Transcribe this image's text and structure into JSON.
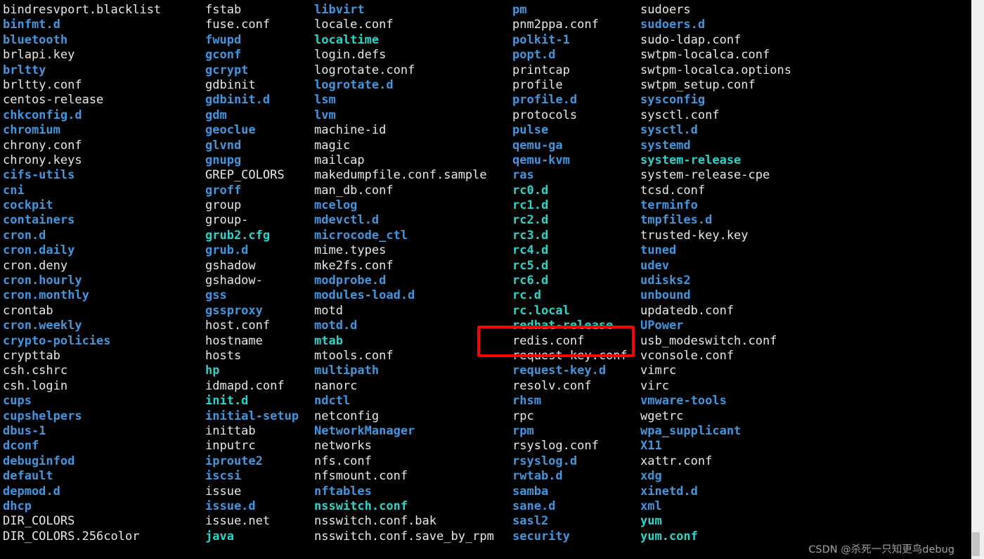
{
  "terminal": {
    "description": "Directory listing of /etc produced by ls",
    "background_color": "#000000",
    "colors": {
      "file": "#e8e8e8",
      "directory": "#4196de",
      "symlink": "#2ad4c8",
      "highlight_border": "#ff0000",
      "scrollbar_track": "#efefef",
      "scrollbar_thumb": "#c4c4c4"
    },
    "columns": [
      {
        "id": "column-1",
        "entries": [
          {
            "name": "bindresvport.blacklist",
            "type": "file"
          },
          {
            "name": "binfmt.d",
            "type": "dir"
          },
          {
            "name": "bluetooth",
            "type": "dir"
          },
          {
            "name": "brlapi.key",
            "type": "file"
          },
          {
            "name": "brltty",
            "type": "dir"
          },
          {
            "name": "brltty.conf",
            "type": "file"
          },
          {
            "name": "centos-release",
            "type": "file"
          },
          {
            "name": "chkconfig.d",
            "type": "dir"
          },
          {
            "name": "chromium",
            "type": "dir"
          },
          {
            "name": "chrony.conf",
            "type": "file"
          },
          {
            "name": "chrony.keys",
            "type": "file"
          },
          {
            "name": "cifs-utils",
            "type": "dir"
          },
          {
            "name": "cni",
            "type": "dir"
          },
          {
            "name": "cockpit",
            "type": "dir"
          },
          {
            "name": "containers",
            "type": "dir"
          },
          {
            "name": "cron.d",
            "type": "dir"
          },
          {
            "name": "cron.daily",
            "type": "dir"
          },
          {
            "name": "cron.deny",
            "type": "file"
          },
          {
            "name": "cron.hourly",
            "type": "dir"
          },
          {
            "name": "cron.monthly",
            "type": "dir"
          },
          {
            "name": "crontab",
            "type": "file"
          },
          {
            "name": "cron.weekly",
            "type": "dir"
          },
          {
            "name": "crypto-policies",
            "type": "dir"
          },
          {
            "name": "crypttab",
            "type": "file"
          },
          {
            "name": "csh.cshrc",
            "type": "file"
          },
          {
            "name": "csh.login",
            "type": "file"
          },
          {
            "name": "cups",
            "type": "dir"
          },
          {
            "name": "cupshelpers",
            "type": "dir"
          },
          {
            "name": "dbus-1",
            "type": "dir"
          },
          {
            "name": "dconf",
            "type": "dir"
          },
          {
            "name": "debuginfod",
            "type": "dir"
          },
          {
            "name": "default",
            "type": "dir"
          },
          {
            "name": "depmod.d",
            "type": "dir"
          },
          {
            "name": "dhcp",
            "type": "dir"
          },
          {
            "name": "DIR_COLORS",
            "type": "file"
          },
          {
            "name": "DIR_COLORS.256color",
            "type": "file"
          }
        ]
      },
      {
        "id": "column-2",
        "entries": [
          {
            "name": "fstab",
            "type": "file"
          },
          {
            "name": "fuse.conf",
            "type": "file"
          },
          {
            "name": "fwupd",
            "type": "dir"
          },
          {
            "name": "gconf",
            "type": "dir"
          },
          {
            "name": "gcrypt",
            "type": "dir"
          },
          {
            "name": "gdbinit",
            "type": "file"
          },
          {
            "name": "gdbinit.d",
            "type": "dir"
          },
          {
            "name": "gdm",
            "type": "dir"
          },
          {
            "name": "geoclue",
            "type": "dir"
          },
          {
            "name": "glvnd",
            "type": "dir"
          },
          {
            "name": "gnupg",
            "type": "dir"
          },
          {
            "name": "GREP_COLORS",
            "type": "file"
          },
          {
            "name": "groff",
            "type": "dir"
          },
          {
            "name": "group",
            "type": "file"
          },
          {
            "name": "group-",
            "type": "file"
          },
          {
            "name": "grub2.cfg",
            "type": "link"
          },
          {
            "name": "grub.d",
            "type": "dir"
          },
          {
            "name": "gshadow",
            "type": "file"
          },
          {
            "name": "gshadow-",
            "type": "file"
          },
          {
            "name": "gss",
            "type": "dir"
          },
          {
            "name": "gssproxy",
            "type": "dir"
          },
          {
            "name": "host.conf",
            "type": "file"
          },
          {
            "name": "hostname",
            "type": "file"
          },
          {
            "name": "hosts",
            "type": "file"
          },
          {
            "name": "hp",
            "type": "link"
          },
          {
            "name": "idmapd.conf",
            "type": "file"
          },
          {
            "name": "init.d",
            "type": "link"
          },
          {
            "name": "initial-setup",
            "type": "dir"
          },
          {
            "name": "inittab",
            "type": "file"
          },
          {
            "name": "inputrc",
            "type": "file"
          },
          {
            "name": "iproute2",
            "type": "dir"
          },
          {
            "name": "iscsi",
            "type": "dir"
          },
          {
            "name": "issue",
            "type": "file"
          },
          {
            "name": "issue.d",
            "type": "dir"
          },
          {
            "name": "issue.net",
            "type": "file"
          },
          {
            "name": "java",
            "type": "link"
          }
        ]
      },
      {
        "id": "column-3",
        "entries": [
          {
            "name": "libvirt",
            "type": "dir"
          },
          {
            "name": "locale.conf",
            "type": "file"
          },
          {
            "name": "localtime",
            "type": "link"
          },
          {
            "name": "login.defs",
            "type": "file"
          },
          {
            "name": "logrotate.conf",
            "type": "file"
          },
          {
            "name": "logrotate.d",
            "type": "dir"
          },
          {
            "name": "lsm",
            "type": "dir"
          },
          {
            "name": "lvm",
            "type": "dir"
          },
          {
            "name": "machine-id",
            "type": "file"
          },
          {
            "name": "magic",
            "type": "file"
          },
          {
            "name": "mailcap",
            "type": "file"
          },
          {
            "name": "makedumpfile.conf.sample",
            "type": "file"
          },
          {
            "name": "man_db.conf",
            "type": "file"
          },
          {
            "name": "mcelog",
            "type": "dir"
          },
          {
            "name": "mdevctl.d",
            "type": "dir"
          },
          {
            "name": "microcode_ctl",
            "type": "dir"
          },
          {
            "name": "mime.types",
            "type": "file"
          },
          {
            "name": "mke2fs.conf",
            "type": "file"
          },
          {
            "name": "modprobe.d",
            "type": "dir"
          },
          {
            "name": "modules-load.d",
            "type": "dir"
          },
          {
            "name": "motd",
            "type": "file"
          },
          {
            "name": "motd.d",
            "type": "dir"
          },
          {
            "name": "mtab",
            "type": "link"
          },
          {
            "name": "mtools.conf",
            "type": "file"
          },
          {
            "name": "multipath",
            "type": "dir"
          },
          {
            "name": "nanorc",
            "type": "file"
          },
          {
            "name": "ndctl",
            "type": "dir"
          },
          {
            "name": "netconfig",
            "type": "file"
          },
          {
            "name": "NetworkManager",
            "type": "dir"
          },
          {
            "name": "networks",
            "type": "file"
          },
          {
            "name": "nfs.conf",
            "type": "file"
          },
          {
            "name": "nfsmount.conf",
            "type": "file"
          },
          {
            "name": "nftables",
            "type": "dir"
          },
          {
            "name": "nsswitch.conf",
            "type": "link"
          },
          {
            "name": "nsswitch.conf.bak",
            "type": "file"
          },
          {
            "name": "nsswitch.conf.save_by_rpm",
            "type": "file"
          }
        ]
      },
      {
        "id": "column-4",
        "entries": [
          {
            "name": "pm",
            "type": "dir"
          },
          {
            "name": "pnm2ppa.conf",
            "type": "file"
          },
          {
            "name": "polkit-1",
            "type": "dir"
          },
          {
            "name": "popt.d",
            "type": "dir"
          },
          {
            "name": "printcap",
            "type": "file"
          },
          {
            "name": "profile",
            "type": "file"
          },
          {
            "name": "profile.d",
            "type": "dir"
          },
          {
            "name": "protocols",
            "type": "file"
          },
          {
            "name": "pulse",
            "type": "dir"
          },
          {
            "name": "qemu-ga",
            "type": "dir"
          },
          {
            "name": "qemu-kvm",
            "type": "dir"
          },
          {
            "name": "ras",
            "type": "dir"
          },
          {
            "name": "rc0.d",
            "type": "link"
          },
          {
            "name": "rc1.d",
            "type": "link"
          },
          {
            "name": "rc2.d",
            "type": "link"
          },
          {
            "name": "rc3.d",
            "type": "link"
          },
          {
            "name": "rc4.d",
            "type": "link"
          },
          {
            "name": "rc5.d",
            "type": "link"
          },
          {
            "name": "rc6.d",
            "type": "link"
          },
          {
            "name": "rc.d",
            "type": "link"
          },
          {
            "name": "rc.local",
            "type": "link"
          },
          {
            "name": "redhat-release",
            "type": "link"
          },
          {
            "name": "redis.conf",
            "type": "file"
          },
          {
            "name": "request-key.conf",
            "type": "file"
          },
          {
            "name": "request-key.d",
            "type": "dir"
          },
          {
            "name": "resolv.conf",
            "type": "file"
          },
          {
            "name": "rhsm",
            "type": "dir"
          },
          {
            "name": "rpc",
            "type": "file"
          },
          {
            "name": "rpm",
            "type": "dir"
          },
          {
            "name": "rsyslog.conf",
            "type": "file"
          },
          {
            "name": "rsyslog.d",
            "type": "dir"
          },
          {
            "name": "rwtab.d",
            "type": "dir"
          },
          {
            "name": "samba",
            "type": "dir"
          },
          {
            "name": "sane.d",
            "type": "dir"
          },
          {
            "name": "sasl2",
            "type": "dir"
          },
          {
            "name": "security",
            "type": "dir"
          }
        ]
      },
      {
        "id": "column-5",
        "entries": [
          {
            "name": "sudoers",
            "type": "file"
          },
          {
            "name": "sudoers.d",
            "type": "dir"
          },
          {
            "name": "sudo-ldap.conf",
            "type": "file"
          },
          {
            "name": "swtpm-localca.conf",
            "type": "file"
          },
          {
            "name": "swtpm-localca.options",
            "type": "file"
          },
          {
            "name": "swtpm_setup.conf",
            "type": "file"
          },
          {
            "name": "sysconfig",
            "type": "dir"
          },
          {
            "name": "sysctl.conf",
            "type": "file"
          },
          {
            "name": "sysctl.d",
            "type": "dir"
          },
          {
            "name": "systemd",
            "type": "dir"
          },
          {
            "name": "system-release",
            "type": "link"
          },
          {
            "name": "system-release-cpe",
            "type": "file"
          },
          {
            "name": "tcsd.conf",
            "type": "file"
          },
          {
            "name": "terminfo",
            "type": "dir"
          },
          {
            "name": "tmpfiles.d",
            "type": "dir"
          },
          {
            "name": "trusted-key.key",
            "type": "file"
          },
          {
            "name": "tuned",
            "type": "dir"
          },
          {
            "name": "udev",
            "type": "dir"
          },
          {
            "name": "udisks2",
            "type": "dir"
          },
          {
            "name": "unbound",
            "type": "dir"
          },
          {
            "name": "updatedb.conf",
            "type": "file"
          },
          {
            "name": "UPower",
            "type": "dir"
          },
          {
            "name": "usb_modeswitch.conf",
            "type": "file"
          },
          {
            "name": "vconsole.conf",
            "type": "file"
          },
          {
            "name": "vimrc",
            "type": "file"
          },
          {
            "name": "virc",
            "type": "file"
          },
          {
            "name": "vmware-tools",
            "type": "dir"
          },
          {
            "name": "wgetrc",
            "type": "file"
          },
          {
            "name": "wpa_supplicant",
            "type": "dir"
          },
          {
            "name": "X11",
            "type": "dir"
          },
          {
            "name": "xattr.conf",
            "type": "file"
          },
          {
            "name": "xdg",
            "type": "dir"
          },
          {
            "name": "xinetd.d",
            "type": "dir"
          },
          {
            "name": "xml",
            "type": "dir"
          },
          {
            "name": "yum",
            "type": "link"
          },
          {
            "name": "yum.conf",
            "type": "link"
          }
        ]
      }
    ],
    "highlight": {
      "label": "redis.conf",
      "secondary_label": "redhat-release",
      "color": "#ff0000"
    }
  },
  "watermark": {
    "text": "CSDN @杀死一只知更鸟debug"
  }
}
